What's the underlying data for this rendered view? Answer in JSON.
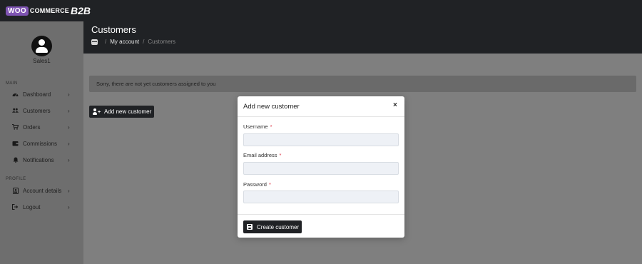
{
  "logo": {
    "woo": "WOO",
    "commerce": "COMMERCE",
    "b2b": "B2B"
  },
  "header": {
    "title": "Customers",
    "breadcrumb": [
      {
        "label": "My account"
      },
      {
        "label": "Customers"
      }
    ],
    "breadcrumb_separator": "/"
  },
  "user": {
    "name": "Sales1"
  },
  "sidebar": {
    "main_label": "MAIN",
    "main_items": [
      {
        "label": "Dashboard",
        "icon": "dashboard-icon"
      },
      {
        "label": "Customers",
        "icon": "users-icon"
      },
      {
        "label": "Orders",
        "icon": "cart-icon"
      },
      {
        "label": "Commissions",
        "icon": "wallet-icon"
      },
      {
        "label": "Notifications",
        "icon": "bell-icon"
      }
    ],
    "profile_label": "PROFILE",
    "profile_items": [
      {
        "label": "Account details",
        "icon": "id-card-icon"
      },
      {
        "label": "Logout",
        "icon": "logout-icon"
      }
    ],
    "chevron": "›"
  },
  "alert": {
    "text": "Sorry, there are not yet customers assigned to you"
  },
  "add_customer_button": {
    "label": "Add new customer",
    "icon": "user-plus-icon"
  },
  "modal": {
    "title": "Add new customer",
    "close": "×",
    "fields": [
      {
        "label": "Username",
        "required": "*",
        "value": "",
        "placeholder": ""
      },
      {
        "label": "Email address",
        "required": "*",
        "value": "",
        "placeholder": ""
      },
      {
        "label": "Password",
        "required": "*",
        "value": "",
        "placeholder": ""
      }
    ],
    "submit": {
      "label": "Create customer",
      "icon": "save-icon"
    }
  },
  "colors": {
    "dark": "#202225",
    "overlay": "#7f7f7f",
    "required": "#dc3545",
    "woo_purple": "#7f54b3"
  }
}
